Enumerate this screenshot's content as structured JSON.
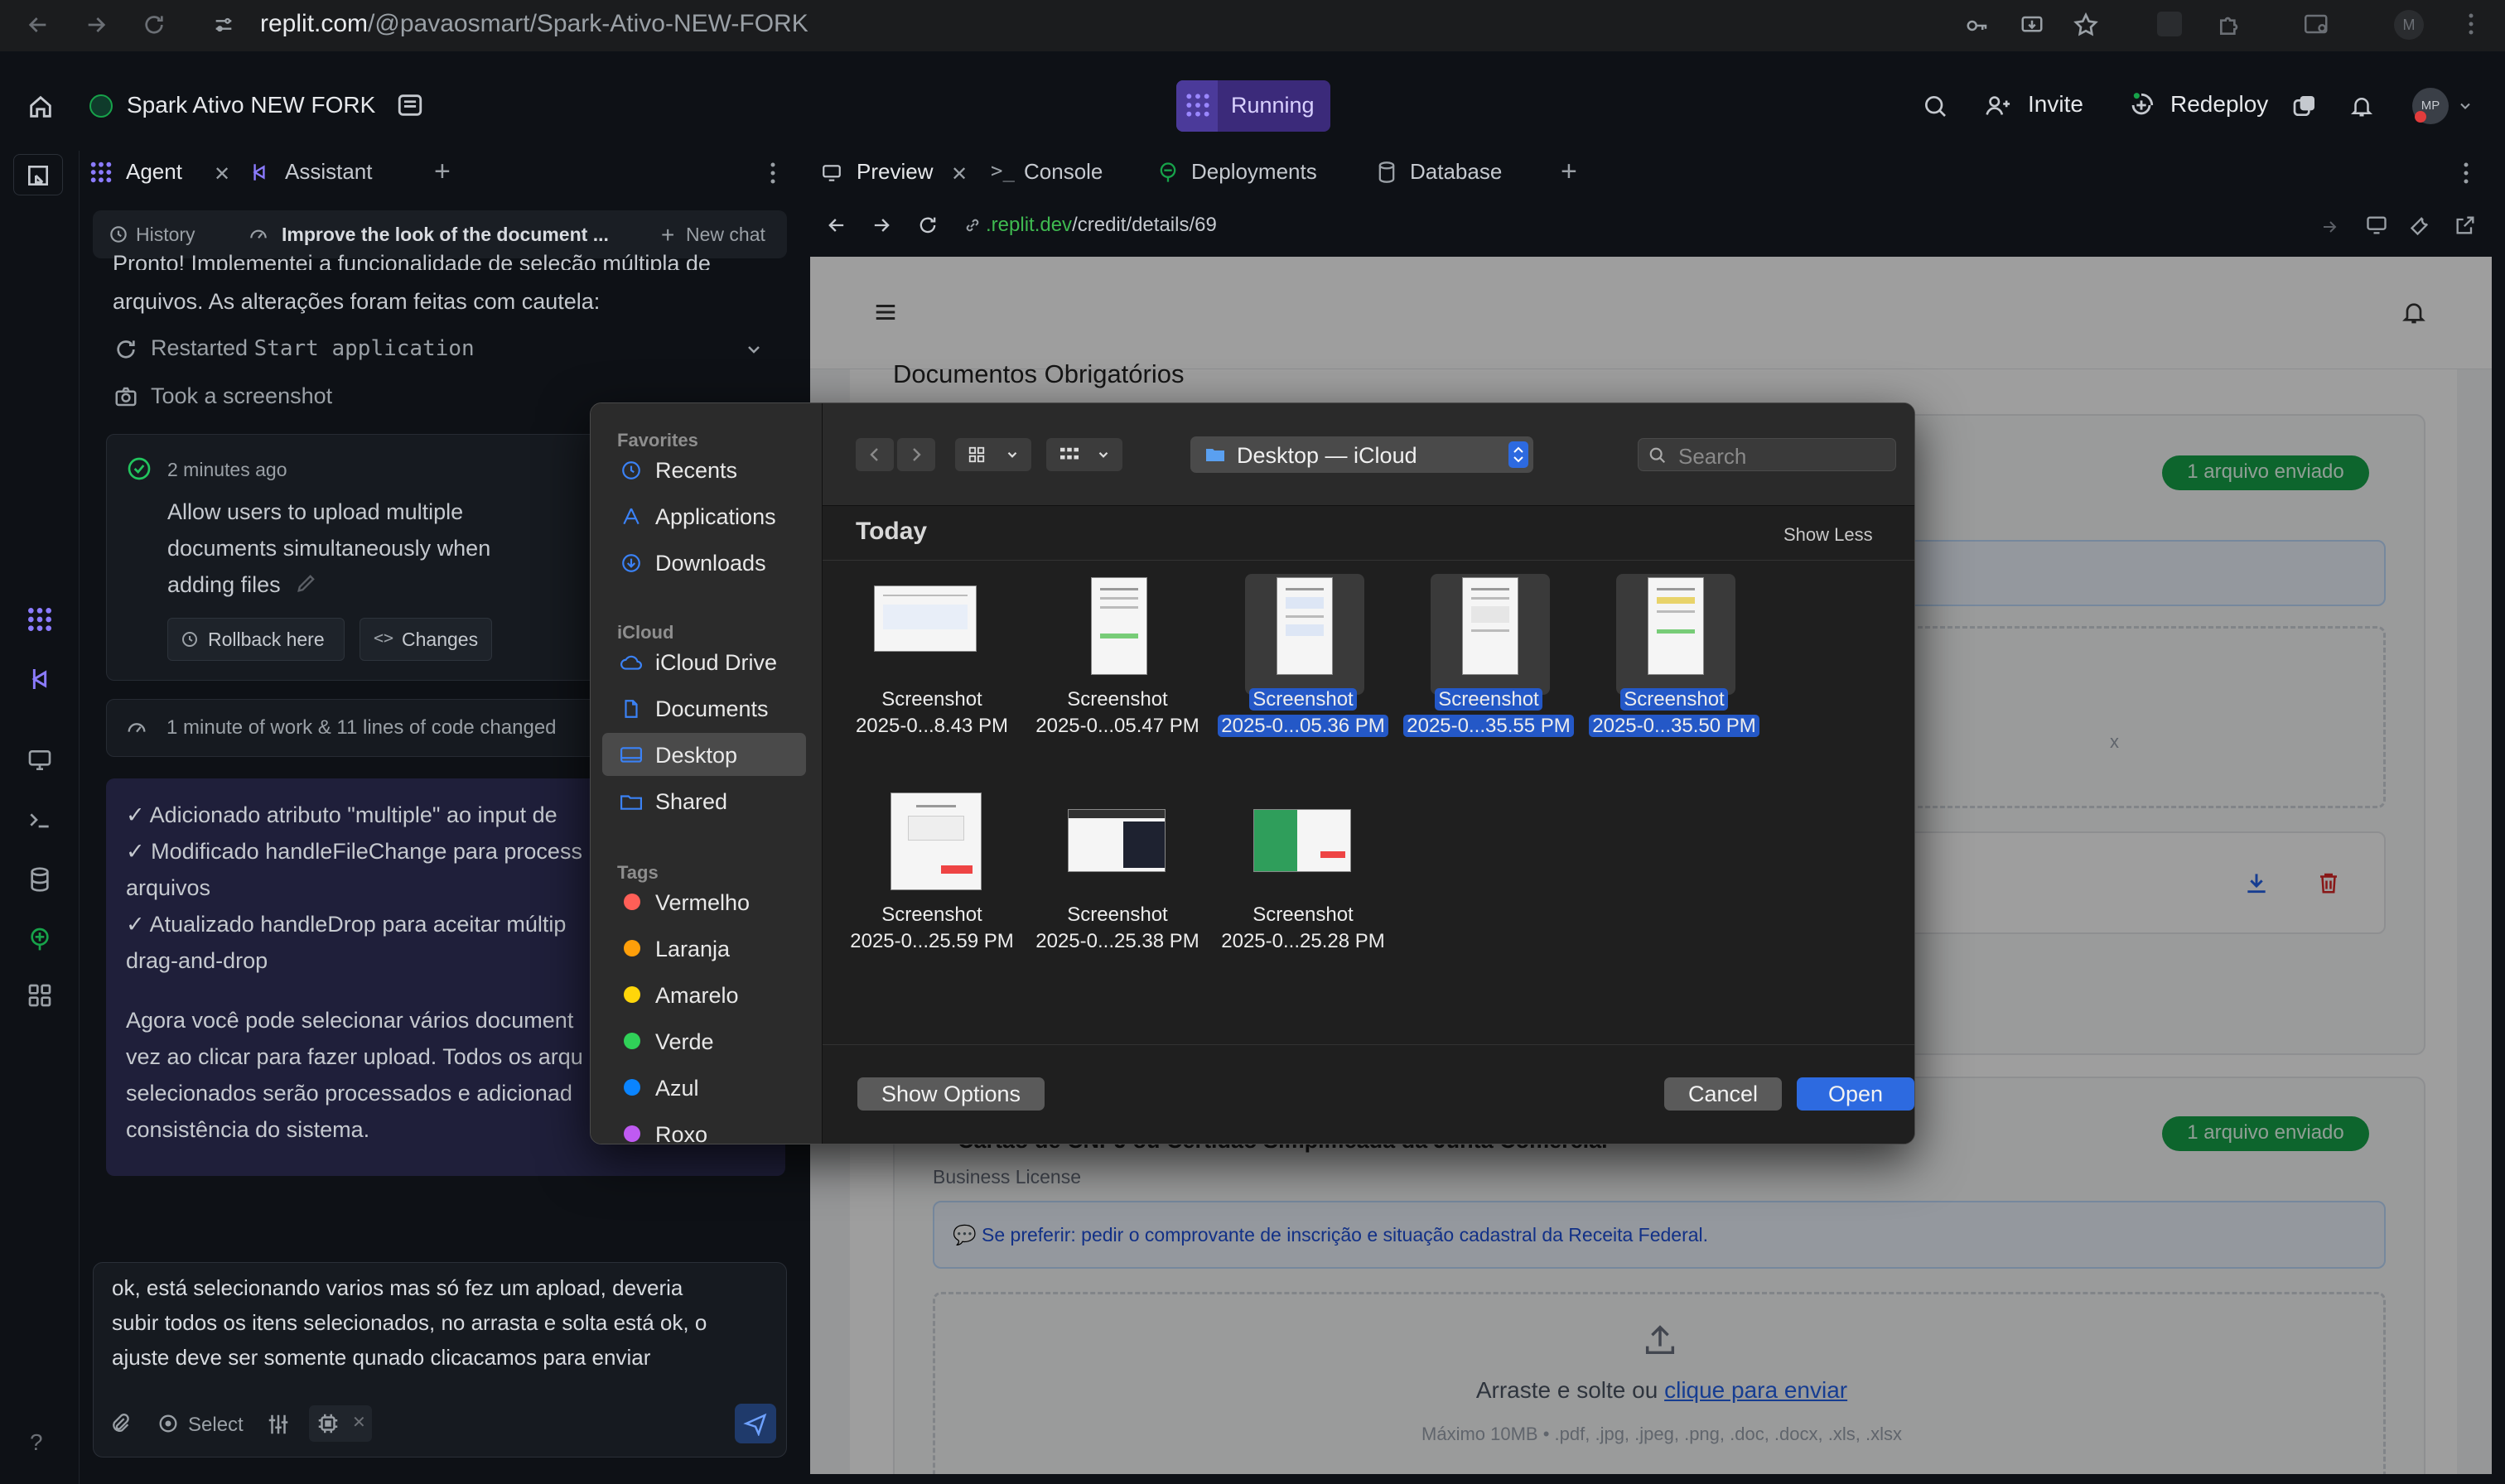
{
  "browser": {
    "url_host": "replit.com",
    "url_path": "/@pavaosmart/Spark-Ativo-NEW-FORK"
  },
  "header": {
    "project_name": "Spark Ativo NEW FORK",
    "status": "Running",
    "invite_label": "Invite",
    "redeploy_label": "Redeploy",
    "avatar_initials": "MP"
  },
  "left_tabs": {
    "agent": "Agent",
    "assistant": "Assistant"
  },
  "chat_bar": {
    "history": "History",
    "chat_title": "Improve the look of the document ...",
    "new_chat": "New chat"
  },
  "chat": {
    "intro_line1": "Pronto! Implementei a funcionalidade de seleção múltipla de",
    "intro_line2": "arquivos. As alterações foram feitas com cautela:",
    "restarted_prefix": "Restarted ",
    "restarted_code": "Start application",
    "screenshot_label": "Took a screenshot",
    "checkpoint_time": "2 minutes ago",
    "checkpoint_line1": "Allow users to upload multiple",
    "checkpoint_line2": "documents simultaneously when",
    "checkpoint_line3": "adding files",
    "rollback_label": "Rollback here",
    "changes_label": "Changes",
    "work_summary": "1 minute of work & 11 lines of code changed",
    "summary_l1": "✓ Adicionado atributo \"multiple\" ao input de",
    "summary_l2": "✓ Modificado handleFileChange para process",
    "summary_l3": "arquivos",
    "summary_l4": "✓ Atualizado handleDrop para aceitar múltip",
    "summary_l5": "drag-and-drop",
    "summary_l6": "Agora você pode selecionar vários document",
    "summary_l7": "vez ao clicar para fazer upload. Todos os arqu",
    "summary_l8": "selecionados serão processados e adicionad",
    "summary_l9": "consistência do sistema."
  },
  "composer": {
    "line1": "ok, está selecionando varios mas só fez um apload, deveria",
    "line2": "subir todos os itens selecionados, no arrasta e solta está ok, o",
    "line3": "ajuste deve ser somente qunado clicacamos para enviar",
    "select_label": "Select"
  },
  "right_tabs": {
    "preview": "Preview",
    "console": "Console",
    "deployments": "Deployments",
    "database": "Database"
  },
  "preview_url": {
    "host": ".replit.dev",
    "path": "/credit/details/69"
  },
  "webpage": {
    "section_title": "Documentos Obrigatórios",
    "badge1": "1 arquivo enviado",
    "badge2": "1 arquivo enviado",
    "partial_x": "x",
    "card2_title": "Cartão de CNPJ ou Certidão Simplificada da Junta Comercial",
    "card2_subtitle": "Business License",
    "hint": "💬 Se preferir: pedir o comprovante de inscrição e situação cadastral da Receita Federal.",
    "drop_text": "Arraste e solte ou ",
    "drop_link": "clique para enviar",
    "drop_limits": "Máximo 10MB • .pdf, .jpg, .jpeg, .png, .doc, .docx, .xls, .xlsx"
  },
  "dialog": {
    "favorites_heading": "Favorites",
    "favorites": [
      "Recents",
      "Applications",
      "Downloads"
    ],
    "icloud_heading": "iCloud",
    "icloud": [
      "iCloud Drive",
      "Documents",
      "Desktop",
      "Shared"
    ],
    "tags_heading": "Tags",
    "tags": [
      {
        "name": "Vermelho",
        "color": "#ff5f57"
      },
      {
        "name": "Laranja",
        "color": "#ff9f0a"
      },
      {
        "name": "Amarelo",
        "color": "#ffd60a"
      },
      {
        "name": "Verde",
        "color": "#30d158"
      },
      {
        "name": "Azul",
        "color": "#0a84ff"
      },
      {
        "name": "Roxo",
        "color": "#bf5af2"
      }
    ],
    "location": "Desktop — iCloud",
    "search_placeholder": "Search",
    "group_label": "Today",
    "show_less": "Show Less",
    "files": [
      {
        "line1": "Screenshot",
        "line2": "2025-0...8.43 PM",
        "selected": false
      },
      {
        "line1": "Screenshot",
        "line2": "2025-0...05.47 PM",
        "selected": false
      },
      {
        "line1": "Screenshot",
        "line2": "2025-0...05.36 PM",
        "selected": true
      },
      {
        "line1": "Screenshot",
        "line2": "2025-0...35.55 PM",
        "selected": true
      },
      {
        "line1": "Screenshot",
        "line2": "2025-0...35.50 PM",
        "selected": true
      },
      {
        "line1": "Screenshot",
        "line2": "2025-0...25.59 PM",
        "selected": false
      },
      {
        "line1": "Screenshot",
        "line2": "2025-0...25.38 PM",
        "selected": false
      },
      {
        "line1": "Screenshot",
        "line2": "2025-0...25.28 PM",
        "selected": false
      }
    ],
    "show_options": "Show Options",
    "cancel": "Cancel",
    "open": "Open"
  },
  "colors": {
    "accent_purple": "#5b4bd6",
    "selection_blue": "#2458c7",
    "success_green": "#16a34a"
  }
}
